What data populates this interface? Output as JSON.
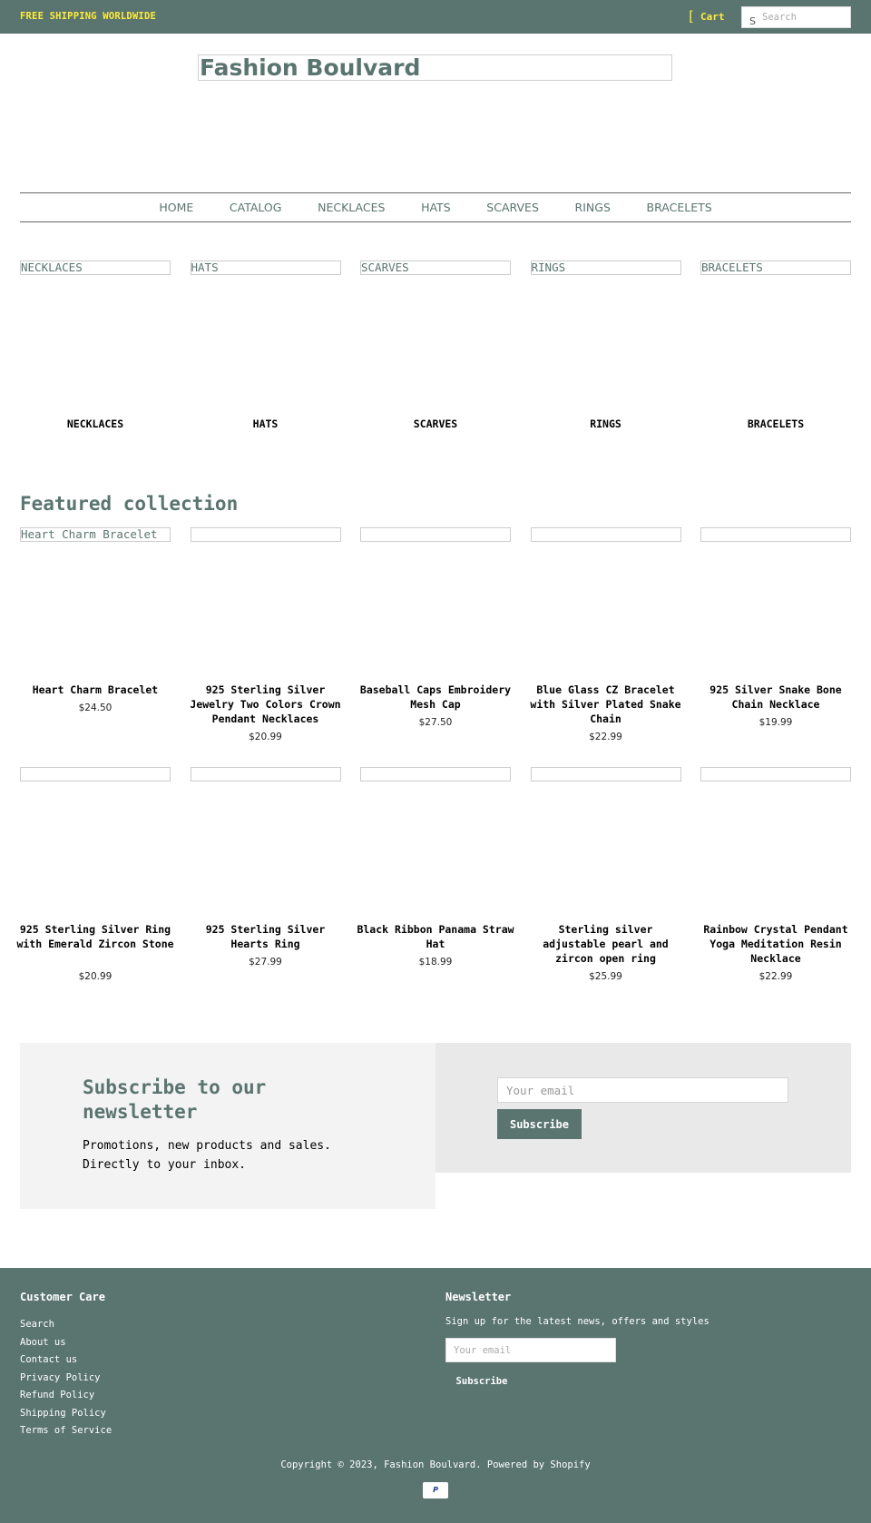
{
  "announcement": {
    "text": "FREE SHIPPING WORLDWIDE"
  },
  "header": {
    "cart_icon": "[",
    "cart_label": "Cart",
    "search_icon": "S",
    "search_placeholder": "Search",
    "logo_text": "Fashion Boulvard"
  },
  "nav": {
    "items": [
      {
        "label": "HOME"
      },
      {
        "label": "CATALOG"
      },
      {
        "label": "NECKLACES"
      },
      {
        "label": "HATS"
      },
      {
        "label": "SCARVES"
      },
      {
        "label": "RINGS"
      },
      {
        "label": "BRACELETS"
      }
    ]
  },
  "collections": [
    {
      "alt": "NECKLACES",
      "label": "NECKLACES"
    },
    {
      "alt": "HATS",
      "label": "HATS"
    },
    {
      "alt": "SCARVES",
      "label": "SCARVES"
    },
    {
      "alt": "RINGS",
      "label": "RINGS"
    },
    {
      "alt": "BRACELETS",
      "label": "BRACELETS"
    }
  ],
  "featured": {
    "title": "Featured collection",
    "products": [
      {
        "alt": "Heart Charm Bracelet",
        "name": "Heart Charm Bracelet",
        "price": "$24.50"
      },
      {
        "alt": "",
        "name": "925 Sterling Silver Jewelry Two Colors Crown Pendant Necklaces",
        "price": "$20.99"
      },
      {
        "alt": "",
        "name": "Baseball Caps Embroidery Mesh Cap",
        "price": "$27.50"
      },
      {
        "alt": "",
        "name": "Blue Glass CZ Bracelet with Silver Plated Snake Chain",
        "price": "$22.99"
      },
      {
        "alt": "",
        "name": "925 Silver Snake Bone Chain Necklace",
        "price": "$19.99"
      },
      {
        "alt": "",
        "name": "925 Sterling Silver Ring with Emerald Zircon Stone",
        "price": "$20.99"
      },
      {
        "alt": "",
        "name": "925 Sterling Silver Hearts Ring",
        "price": "$27.99"
      },
      {
        "alt": "",
        "name": "Black Ribbon Panama Straw Hat",
        "price": "$18.99"
      },
      {
        "alt": "",
        "name": "Sterling silver adjustable pearl and zircon open ring",
        "price": "$25.99"
      },
      {
        "alt": "",
        "name": "Rainbow Crystal Pendant Yoga Meditation Resin Necklace",
        "price": "$22.99"
      }
    ]
  },
  "newsletter": {
    "title": "Subscribe to our newsletter",
    "text": "Promotions, new products and sales. Directly to your inbox.",
    "email_placeholder": "Your email",
    "button": "Subscribe"
  },
  "footer": {
    "care_title": "Customer Care",
    "links": [
      {
        "label": "Search"
      },
      {
        "label": "About us"
      },
      {
        "label": "Contact us"
      },
      {
        "label": "Privacy Policy"
      },
      {
        "label": "Refund Policy"
      },
      {
        "label": "Shipping Policy"
      },
      {
        "label": "Terms of Service"
      }
    ],
    "newsletter_title": "Newsletter",
    "newsletter_text": "Sign up for the latest news, offers and styles",
    "email_placeholder": "Your email",
    "button": "Subscribe",
    "copyright": "Copyright © 2023, Fashion Boulvard. Powered by Shopify",
    "payment_icon": "paypal-icon",
    "payment_label": "P"
  },
  "colors": {
    "brand": "#5a7570",
    "announcement_text": "#ffeb3b",
    "newsletter_left_bg": "#f3f3f3",
    "newsletter_right_bg": "#e9e9e9"
  }
}
